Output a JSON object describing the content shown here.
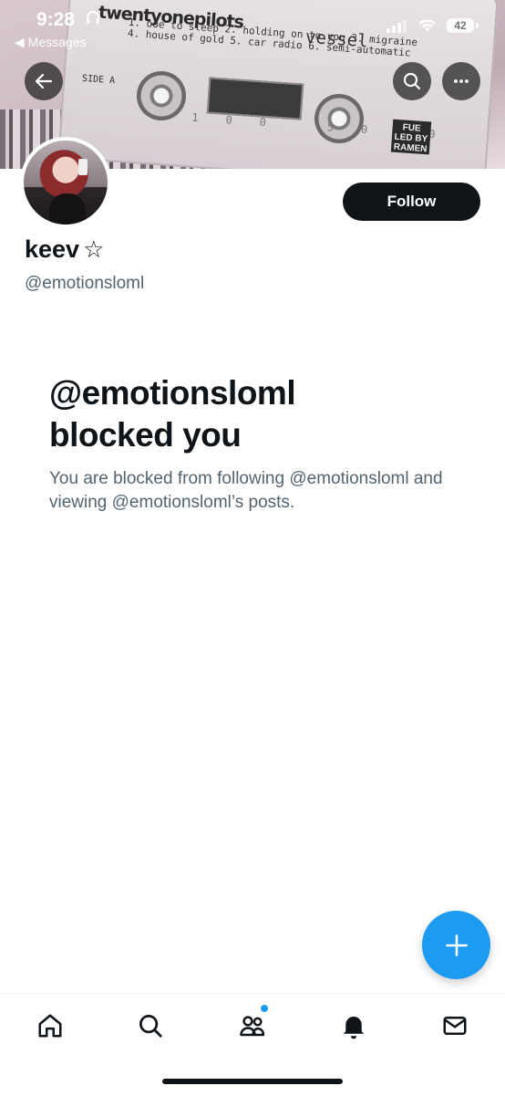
{
  "status_bar": {
    "time": "9:28",
    "back_label": "◀ Messages",
    "battery": "42"
  },
  "banner": {
    "band": "twentyonepilots",
    "album": "vessel",
    "tracks_line1": "1. ode to sleep 2. holding on to you 3. migraine",
    "tracks_line2": "4. house of gold 5. car radio 6. semi-automatic",
    "side": "SIDE A",
    "scale": "100 50 0",
    "badge": "FUE LED BY RAMEN"
  },
  "header_buttons": {
    "back_icon": "arrow-left-icon",
    "search_icon": "search-icon",
    "more_icon": "more-horizontal-icon"
  },
  "profile": {
    "name": "keev",
    "name_symbol": "☆",
    "handle": "@emotionsloml",
    "follow_label": "Follow"
  },
  "blocked": {
    "title_line1": "@emotionsloml",
    "title_line2": "blocked you",
    "description": "You are blocked from following @emotionsloml and viewing @emotionsloml’s posts."
  },
  "fab": {
    "icon": "plus-icon",
    "color": "#1d9bf0"
  },
  "tab_bar": {
    "items": [
      {
        "name": "home",
        "icon": "home-icon"
      },
      {
        "name": "search",
        "icon": "search-icon"
      },
      {
        "name": "communities",
        "icon": "people-icon",
        "has_badge": true
      },
      {
        "name": "notifications",
        "icon": "bell-icon"
      },
      {
        "name": "messages",
        "icon": "mail-icon"
      }
    ]
  },
  "colors": {
    "text_primary": "#0f1419",
    "text_secondary": "#536471",
    "accent": "#1d9bf0"
  }
}
